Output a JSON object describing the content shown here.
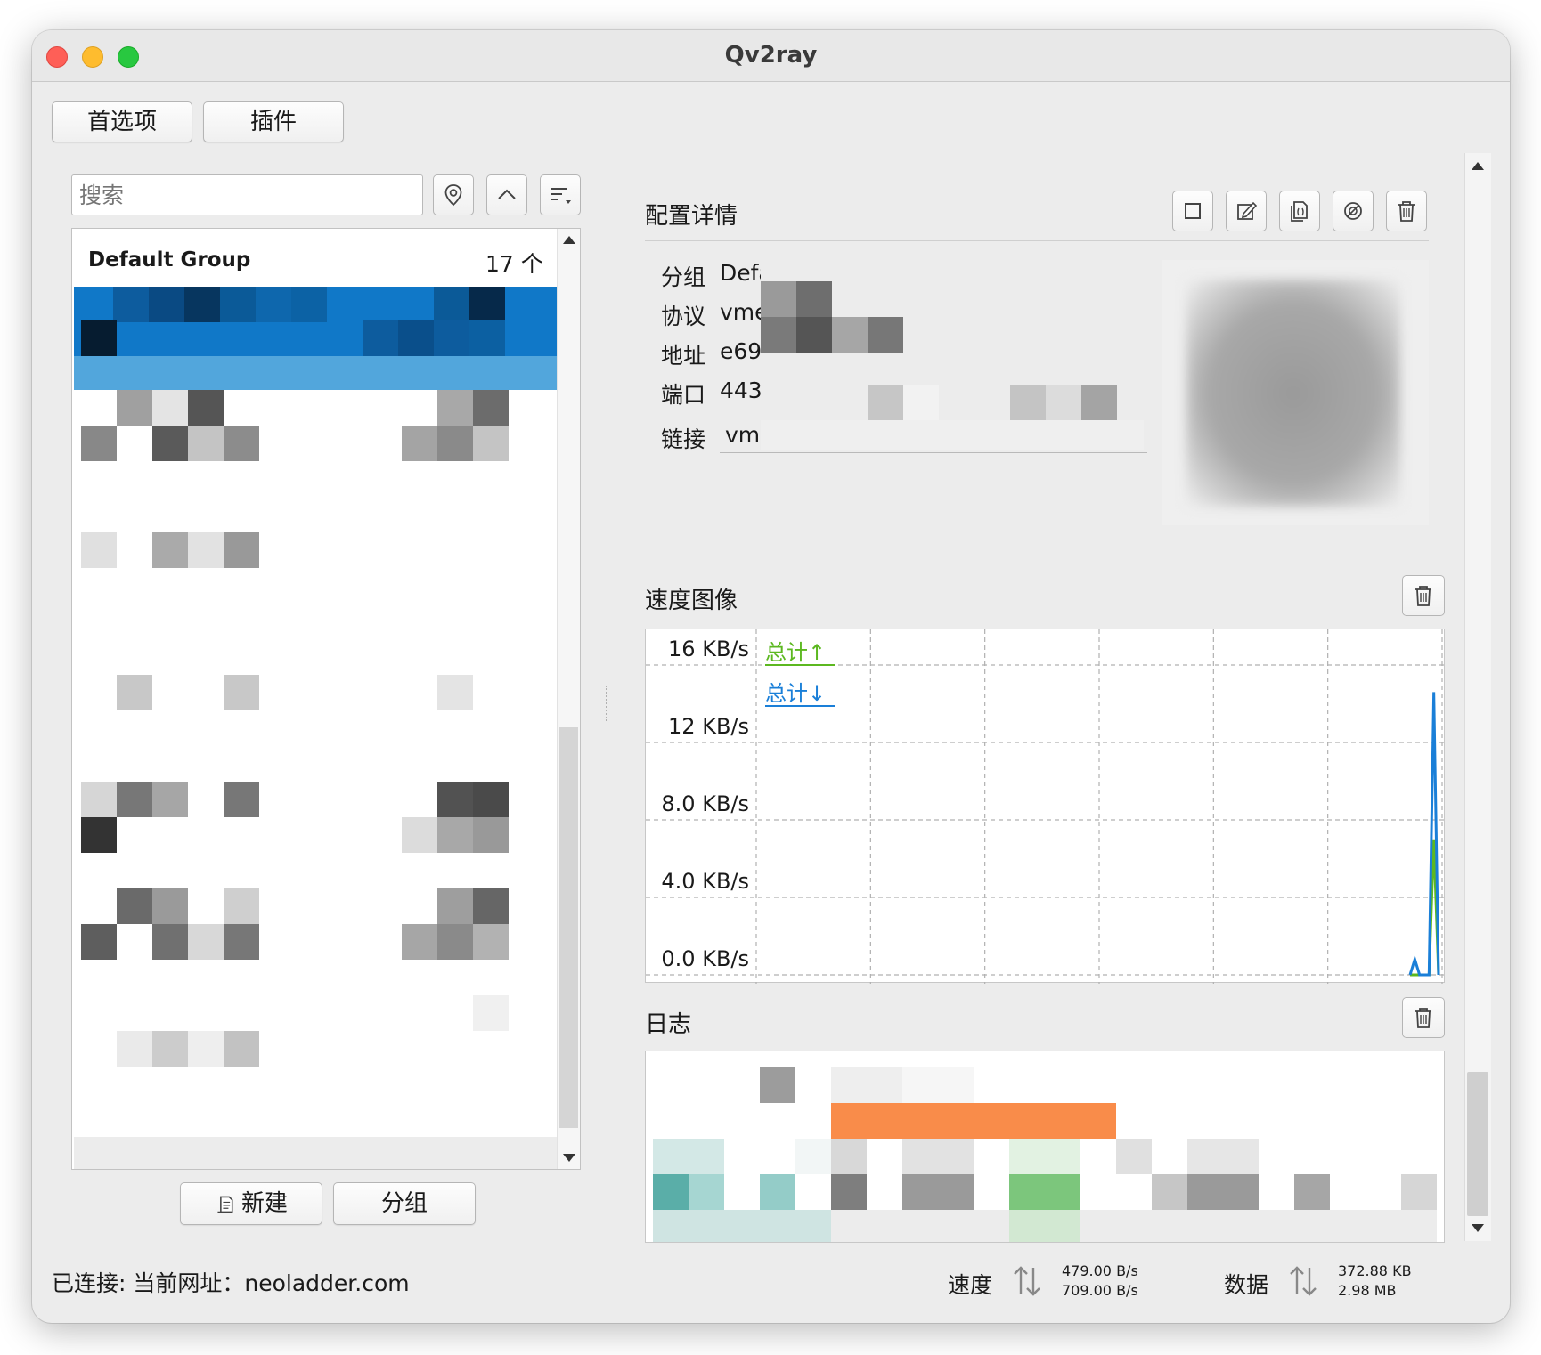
{
  "window": {
    "title": "Qv2ray"
  },
  "toolbar": {
    "preferences_label": "首选项",
    "plugins_label": "插件"
  },
  "search": {
    "placeholder": "搜索"
  },
  "connection_list": {
    "group_name": "Default Group",
    "group_count": "17 个"
  },
  "list_buttons": {
    "new_label": "新建",
    "group_label": "分组"
  },
  "config_details": {
    "title": "配置详情",
    "rows": [
      {
        "label": "分组",
        "value": "Defa"
      },
      {
        "label": "协议",
        "value": "vme"
      },
      {
        "label": "地址",
        "value": "e69"
      },
      {
        "label": "端口",
        "value": "443"
      },
      {
        "label": "链接",
        "value": "vm"
      }
    ]
  },
  "speed_chart": {
    "title": "速度图像",
    "legend_up": "总计↑",
    "legend_down": "总计↓"
  },
  "chart_data": {
    "type": "line",
    "ylabel": "",
    "ytick_labels": [
      "16 KB/s",
      "12 KB/s",
      "8.0 KB/s",
      "4.0 KB/s",
      "0.0 KB/s"
    ],
    "ylim": [
      0,
      16
    ],
    "x": [
      0,
      1,
      2,
      3,
      4,
      5,
      6
    ],
    "series": [
      {
        "name": "总计↑",
        "color": "#5cb820",
        "values": [
          0,
          0,
          0,
          0,
          0,
          7.0,
          0
        ]
      },
      {
        "name": "总计↓",
        "color": "#1a7fd8",
        "values": [
          0,
          0.8,
          0,
          0,
          0,
          14.6,
          0
        ]
      }
    ],
    "grid": true
  },
  "log": {
    "title": "日志"
  },
  "statusbar": {
    "connected_text": "已连接: 当前网址：neoladder.com",
    "speed_label": "速度",
    "speed_up": "479.00 B/s",
    "speed_down": "709.00 B/s",
    "data_label": "数据",
    "data_up": "372.88 KB",
    "data_down": "2.98 MB"
  },
  "colors": {
    "accent": "#1078c8",
    "up_series": "#5cb820",
    "down_series": "#1a7fd8",
    "log_highlight": "#f98c4a"
  },
  "icons": [
    "location-icon",
    "collapse-up-icon",
    "sort-icon",
    "stop-icon",
    "edit-icon",
    "copy-icon",
    "share-icon",
    "trash-icon",
    "new-document-icon",
    "updown-arrows-icon"
  ]
}
